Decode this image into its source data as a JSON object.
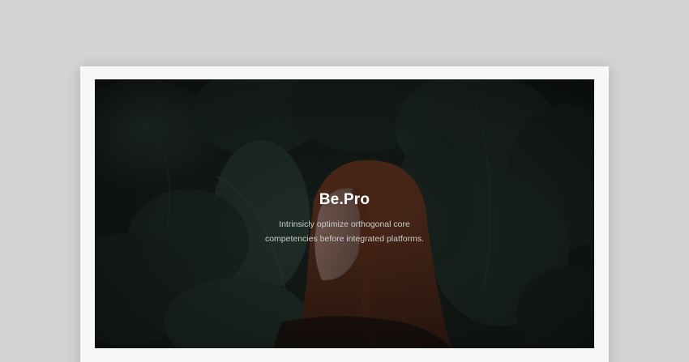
{
  "hero": {
    "title": "Be.Pro",
    "tagline_line1": "Intrinsicly optimize orthogonal core",
    "tagline_line2": "competencies before integrated platforms."
  },
  "colors": {
    "page_background": "#d4d4d4",
    "frame": "#f7f7f7",
    "hero_dark": "#161d1a",
    "leaf_green": "#1f2c27",
    "hair": "#6b3a22",
    "skin": "#8a6e66"
  },
  "image": {
    "subject": "woman-with-red-hair-among-dark-leaves"
  }
}
